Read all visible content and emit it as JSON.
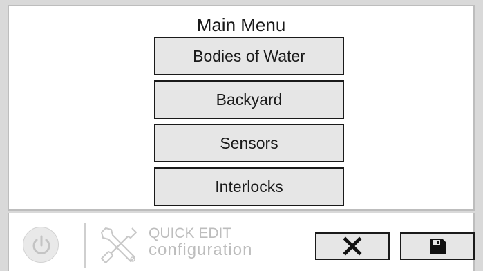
{
  "main_menu": {
    "title": "Main Menu",
    "items": [
      {
        "label": "Bodies of Water"
      },
      {
        "label": "Backyard"
      },
      {
        "label": "Sensors"
      },
      {
        "label": "Interlocks"
      }
    ]
  },
  "bottom_bar": {
    "power_icon": "power-icon",
    "tools_icon": "tools-icon",
    "quick_edit_title": "QUICK EDIT",
    "quick_edit_subtitle": "configuration",
    "cancel_icon": "close-icon",
    "save_icon": "floppy-disk-icon"
  },
  "colors": {
    "background": "#d9d9d9",
    "panel": "#ffffff",
    "button_fill": "#e6e6e6",
    "button_border": "#1a1a1a",
    "disabled_text": "#bdbdbd"
  }
}
